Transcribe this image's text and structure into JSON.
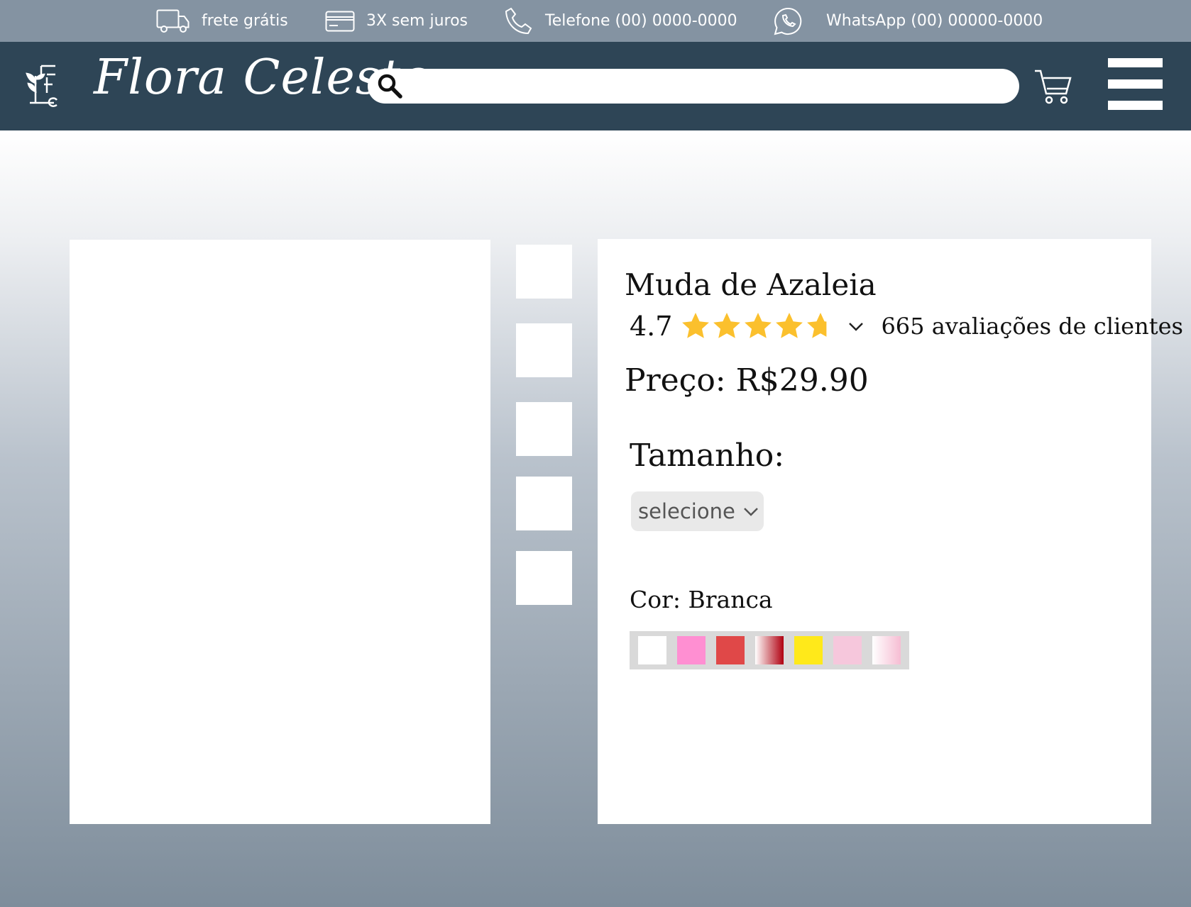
{
  "topbar": {
    "items": [
      {
        "label": "frete grátis",
        "icon": "truck-icon"
      },
      {
        "label": "3X sem juros",
        "icon": "credit-card-icon"
      },
      {
        "label": "Telefone (00) 0000-0000",
        "icon": "phone-icon"
      },
      {
        "label": "WhatsApp (00) 00000-0000",
        "icon": "whatsapp-icon"
      }
    ]
  },
  "header": {
    "brand": "Flora Celeste",
    "logo_icon": "flora-celeste-logo-icon",
    "search": {
      "value": "",
      "placeholder": "",
      "icon": "search-icon"
    },
    "cart_icon": "cart-icon",
    "menu_icon": "hamburger-menu-icon",
    "background": "#2e4556"
  },
  "product": {
    "title": "Muda de Azaleia",
    "rating": {
      "value": "4.7",
      "stars": 4.7,
      "max_stars": 5,
      "star_color": "#fbc02d"
    },
    "reviews_text": "665 avaliações de clientes",
    "price_text": "Preço: R$29.90",
    "size": {
      "label": "Tamanho:",
      "selected": "selecione"
    },
    "color": {
      "label": "Cor: Branca",
      "swatches": [
        {
          "name": "branca",
          "color": "#ffffff"
        },
        {
          "name": "rosa",
          "color": "#ff8fd2"
        },
        {
          "name": "vermelha",
          "color": "#e04848"
        },
        {
          "name": "branca-vermelha",
          "color": "linear-gradient(to right,#ffffff,#b00010)"
        },
        {
          "name": "amarela",
          "color": "#ffe91a"
        },
        {
          "name": "rosa-claro",
          "color": "#f6c7dc"
        },
        {
          "name": "branca-rosa",
          "color": "linear-gradient(to right,#ffffff,#f6bdd3)"
        }
      ]
    },
    "thumbnail_count": 5
  }
}
